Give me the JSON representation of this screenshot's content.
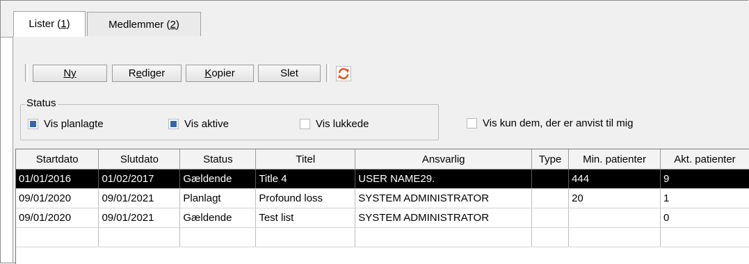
{
  "tabs": [
    {
      "label_pre": "Lister (",
      "label_u": "1",
      "label_post": ")"
    },
    {
      "label_pre": "Medlemmer (",
      "label_u": "2",
      "label_post": ")"
    }
  ],
  "toolbar": {
    "new": {
      "u": "N",
      "rest": "y"
    },
    "edit": {
      "pre": "R",
      "u": "e",
      "rest": "diger"
    },
    "copy": {
      "u": "K",
      "rest": "opier"
    },
    "delete": "Slet",
    "refresh_icon": "refresh-icon",
    "refresh_color": "#e8501e"
  },
  "status": {
    "label": "Status",
    "planned": {
      "label": "Vis planlagte",
      "checked": true
    },
    "active": {
      "label": "Vis aktive",
      "checked": true
    },
    "closed": {
      "label": "Vis lukkede",
      "checked": false
    }
  },
  "assigned_filter": {
    "label": "Vis kun dem, der er anvist til mig",
    "checked": false
  },
  "table": {
    "columns": [
      "Startdato",
      "Slutdato",
      "Status",
      "Titel",
      "Ansvarlig",
      "Type",
      "Min. patienter",
      "Akt. patienter"
    ],
    "rows": [
      [
        "01/01/2016",
        "01/02/2017",
        "Gældende",
        "Title 4",
        "USER NAME29.",
        "",
        "444",
        "9"
      ],
      [
        "09/01/2020",
        "09/01/2021",
        "Planlagt",
        "Profound loss",
        "SYSTEM ADMINISTRATOR",
        "",
        "20",
        "1"
      ],
      [
        "09/01/2020",
        "09/01/2021",
        "Gældende",
        "Test list",
        "SYSTEM ADMINISTRATOR",
        "",
        "",
        "0"
      ],
      [
        "",
        "",
        "",
        "",
        "",
        "",
        "",
        ""
      ]
    ],
    "selected_row": 0
  },
  "colors": {
    "selection_bg": "#000000",
    "checkbox_fill": "#2f68b5"
  }
}
